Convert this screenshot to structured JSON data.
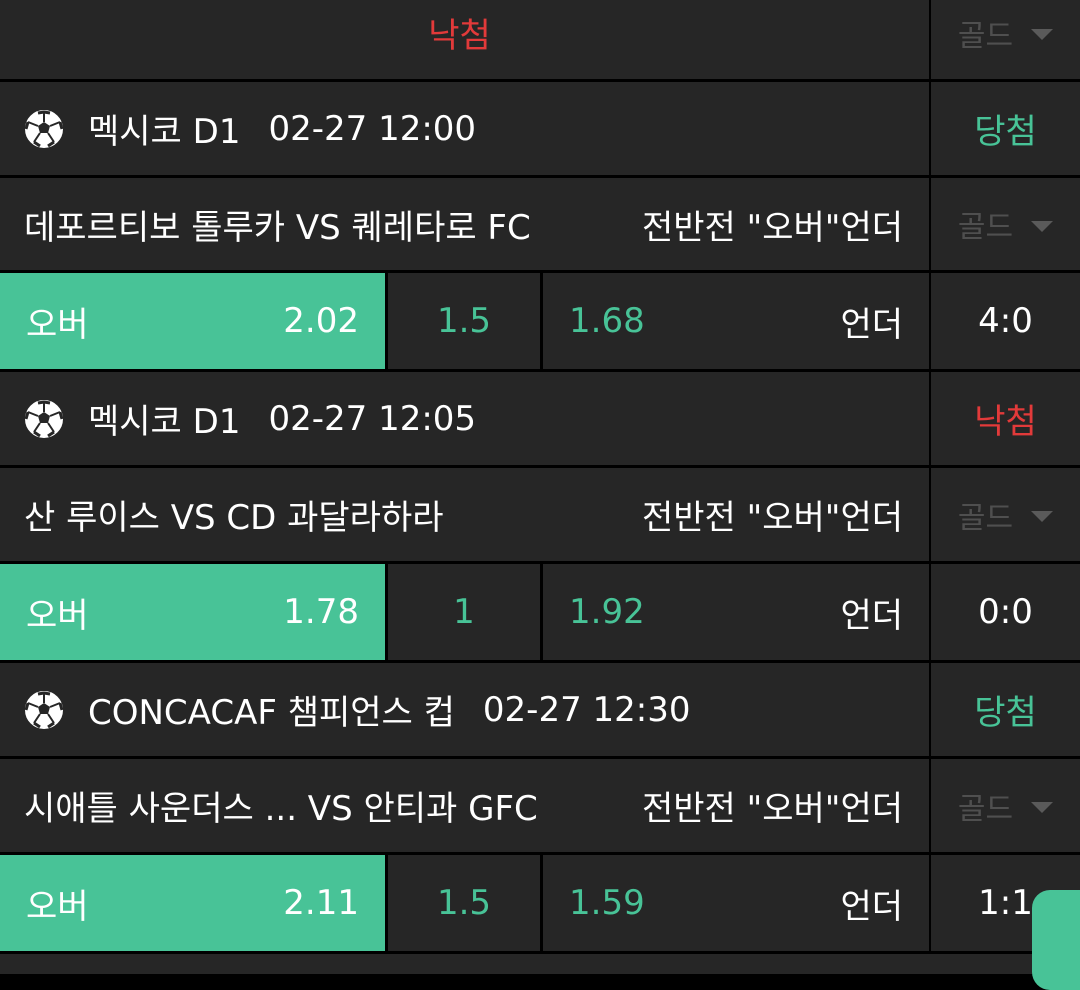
{
  "top": {
    "status": "낙첨",
    "gold": "골드"
  },
  "matches": [
    {
      "league": "멕시코 D1",
      "datetime": "02-27 12:00",
      "result": "당첨",
      "teams": "데포르티보 톨루카 VS 퀘레타로 FC",
      "market": "전반전 \"오버\"언더",
      "gold": "골드",
      "over_label": "오버",
      "over_odds": "2.02",
      "line": "1.5",
      "under_odds": "1.68",
      "under_label": "언더",
      "score": "4:0"
    },
    {
      "league": "멕시코 D1",
      "datetime": "02-27 12:05",
      "result": "낙첨",
      "teams": "산 루이스 VS CD 과달라하라",
      "market": "전반전 \"오버\"언더",
      "gold": "골드",
      "over_label": "오버",
      "over_odds": "1.78",
      "line": "1",
      "under_odds": "1.92",
      "under_label": "언더",
      "score": "0:0"
    },
    {
      "league": "CONCACAF 챔피언스 컵",
      "datetime": "02-27 12:30",
      "result": "당첨",
      "teams": "시애틀 사운더스 ...  VS 안티과 GFC",
      "market": "전반전 \"오버\"언더",
      "gold": "골드",
      "over_label": "오버",
      "over_odds": "2.11",
      "line": "1.5",
      "under_odds": "1.59",
      "under_label": "언더",
      "score": "1:1"
    }
  ],
  "colors": {
    "win": "#48c397",
    "lose": "#e23a3a",
    "bg": "#262626",
    "selected": "#48c397"
  },
  "icons": {
    "sport": "soccer-ball-icon",
    "dropdown": "chevron-down-icon"
  }
}
